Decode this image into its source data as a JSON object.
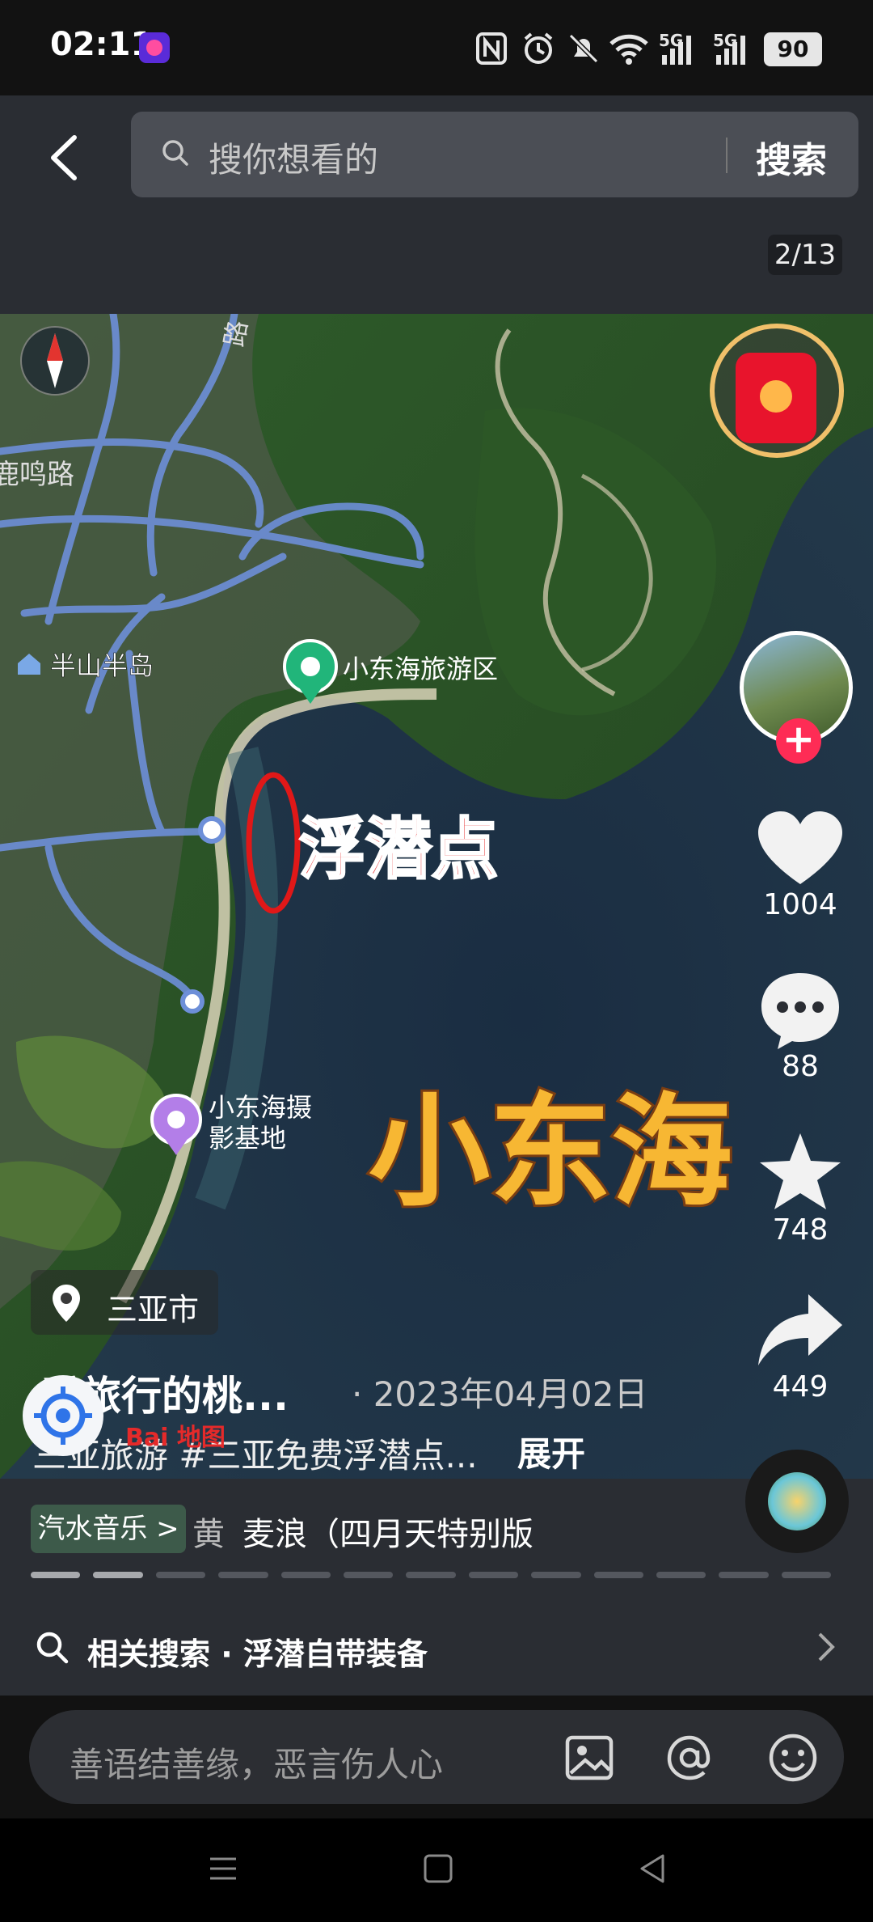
{
  "status_bar": {
    "time": "02:11",
    "signal_1": "5G",
    "signal_2": "5G",
    "battery": "90",
    "icons": [
      "nfc-icon",
      "alarm-icon",
      "mute-icon",
      "wifi-icon",
      "signal-5g-icon",
      "battery-icon"
    ]
  },
  "header": {
    "search_placeholder": "搜你想看的",
    "search_button": "搜索",
    "page_counter": "2/13"
  },
  "map": {
    "labels": {
      "road_top": "路",
      "road_left": "鹿鸣路",
      "place_banshan": "半山半岛",
      "place_xiaodonghai_scenic": "小东海旅游区",
      "place_photo_base_line1": "小东海摄",
      "place_photo_base_line2": "影基地",
      "snorkel_point": "浮潜点",
      "big_title": "小东海"
    },
    "colors": {
      "sea": "#1d3346",
      "land": "#2f5a2a",
      "road": "#6d8fd8",
      "annotation_red": "#e01818",
      "title_yellow": "#f7b733",
      "pin_green": "#21b57a",
      "pin_purple": "#b37ee8"
    }
  },
  "rail": {
    "likes": "1004",
    "comments": "88",
    "favorites": "748",
    "shares": "449"
  },
  "post": {
    "location": "三亚市",
    "author": "爱旅行的桃...",
    "date": "· 2023年04月02日",
    "caption": "三亚旅游 #三亚免费浮潜点...",
    "expand": "展开",
    "baidu_logo": "Bai 地图"
  },
  "music": {
    "tag": "汽水音乐 >",
    "title_prefix": "黄",
    "title": "麦浪（四月天特别版",
    "progress_segments": 13,
    "progress_current": 2
  },
  "related": {
    "label": "相关搜索 · 浮潜自带装备"
  },
  "comment": {
    "placeholder": "善语结善缘，恶言伤人心"
  }
}
